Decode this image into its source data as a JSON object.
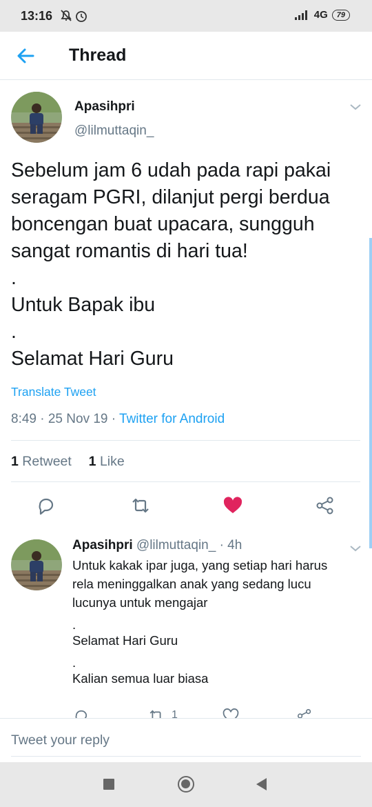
{
  "status_bar": {
    "time": "13:16",
    "network": "4G",
    "battery": "79"
  },
  "header": {
    "title": "Thread"
  },
  "tweet": {
    "name": "Apasihpri",
    "handle": "@lilmuttaqin_",
    "text_lines": [
      "Sebelum jam 6 udah pada rapi pakai",
      "seragam PGRI, dilanjut pergi berdua",
      "boncengan buat upacara, sungguh",
      "sangat romantis di hari tua!",
      ".",
      "Untuk Bapak ibu",
      ".",
      "Selamat Hari Guru"
    ],
    "translate": "Translate Tweet",
    "time": "8:49 · 25 Nov 19 · ",
    "source": "Twitter for Android",
    "retweets_count": "1",
    "retweets_label": "Retweet",
    "likes_count": "1",
    "likes_label": "Like",
    "like_color": "#e0245e"
  },
  "reply": {
    "name": "Apasihpri",
    "handle_time": "@lilmuttaqin_ · 4h",
    "text_lines": [
      "Untuk kakak ipar juga, yang setiap hari harus",
      "rela meninggalkan anak yang sedang lucu",
      "lucunya untuk mengajar",
      ".",
      "Selamat Hari Guru",
      ".",
      "Kalian semua luar biasa"
    ],
    "retweet_count": "1"
  },
  "reply_bar": {
    "placeholder": "Tweet your reply"
  },
  "colors": {
    "accent": "#1da1f2",
    "secondary_text": "#657786"
  }
}
